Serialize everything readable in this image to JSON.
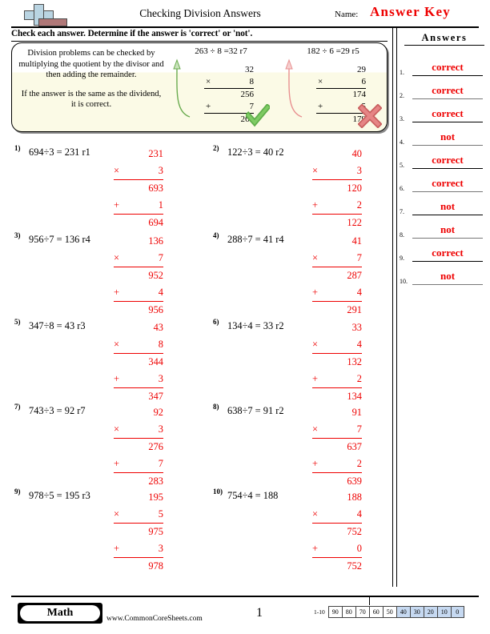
{
  "header": {
    "title": "Checking Division Answers",
    "name_label": "Name:",
    "answer_key": "Answer Key",
    "logo_icon": "plus-logo-icon"
  },
  "instruction": "Check each answer. Determine if the answer is 'correct' or 'not'.",
  "example": {
    "paragraph1": "Division problems can be checked by multiplying the quotient by the divisor and then adding the remainder.",
    "paragraph2": "If the answer is the same as the dividend, it is correct.",
    "samples": [
      {
        "heading": "263 ÷ 8 =32 r7",
        "product_top": "32",
        "mult_op": "×",
        "mult_by": "8",
        "product": "256",
        "add_op": "+",
        "remainder": "7",
        "total": "263",
        "mark": "check-mark",
        "mark_color": "#5fae4a"
      },
      {
        "heading": "182 ÷ 6 =29 r5",
        "product_top": "29",
        "mult_op": "×",
        "mult_by": "6",
        "product": "174",
        "add_op": "+",
        "remainder": "5",
        "total": "179",
        "mark": "x-mark",
        "mark_color": "#e07b7b"
      }
    ]
  },
  "problems": [
    {
      "num": "1)",
      "expr": "694÷3 = 231 r1",
      "top": "231",
      "mult_op": "×",
      "mult_by": "3",
      "product": "693",
      "add_op": "+",
      "remainder": "1",
      "total": "694"
    },
    {
      "num": "2)",
      "expr": "122÷3 = 40 r2",
      "top": "40",
      "mult_op": "×",
      "mult_by": "3",
      "product": "120",
      "add_op": "+",
      "remainder": "2",
      "total": "122"
    },
    {
      "num": "3)",
      "expr": "956÷7 = 136 r4",
      "top": "136",
      "mult_op": "×",
      "mult_by": "7",
      "product": "952",
      "add_op": "+",
      "remainder": "4",
      "total": "956"
    },
    {
      "num": "4)",
      "expr": "288÷7 = 41 r4",
      "top": "41",
      "mult_op": "×",
      "mult_by": "7",
      "product": "287",
      "add_op": "+",
      "remainder": "4",
      "total": "291"
    },
    {
      "num": "5)",
      "expr": "347÷8 = 43 r3",
      "top": "43",
      "mult_op": "×",
      "mult_by": "8",
      "product": "344",
      "add_op": "+",
      "remainder": "3",
      "total": "347"
    },
    {
      "num": "6)",
      "expr": "134÷4 = 33 r2",
      "top": "33",
      "mult_op": "×",
      "mult_by": "4",
      "product": "132",
      "add_op": "+",
      "remainder": "2",
      "total": "134"
    },
    {
      "num": "7)",
      "expr": "743÷3 = 92 r7",
      "top": "92",
      "mult_op": "×",
      "mult_by": "3",
      "product": "276",
      "add_op": "+",
      "remainder": "7",
      "total": "283"
    },
    {
      "num": "8)",
      "expr": "638÷7 = 91 r2",
      "top": "91",
      "mult_op": "×",
      "mult_by": "7",
      "product": "637",
      "add_op": "+",
      "remainder": "2",
      "total": "639"
    },
    {
      "num": "9)",
      "expr": "978÷5 = 195 r3",
      "top": "195",
      "mult_op": "×",
      "mult_by": "5",
      "product": "975",
      "add_op": "+",
      "remainder": "3",
      "total": "978"
    },
    {
      "num": "10)",
      "expr": "754÷4 = 188",
      "top": "188",
      "mult_op": "×",
      "mult_by": "4",
      "product": "752",
      "add_op": "+",
      "remainder": "0",
      "total": "752"
    }
  ],
  "answers": {
    "title": "Answers",
    "color": "#ee0000",
    "items": [
      {
        "idx": "1.",
        "value": "correct"
      },
      {
        "idx": "2.",
        "value": "correct"
      },
      {
        "idx": "3.",
        "value": "correct"
      },
      {
        "idx": "4.",
        "value": "not"
      },
      {
        "idx": "5.",
        "value": "correct"
      },
      {
        "idx": "6.",
        "value": "correct"
      },
      {
        "idx": "7.",
        "value": "not"
      },
      {
        "idx": "8.",
        "value": "not"
      },
      {
        "idx": "9.",
        "value": "correct"
      },
      {
        "idx": "10.",
        "value": "not"
      }
    ]
  },
  "footer": {
    "subject": "Math",
    "url": "www.CommonCoreSheets.com",
    "page_number": "1",
    "scale_label": "1-10",
    "scale_cells": [
      {
        "value": "90",
        "highlighted": false
      },
      {
        "value": "80",
        "highlighted": false
      },
      {
        "value": "70",
        "highlighted": false
      },
      {
        "value": "60",
        "highlighted": false
      },
      {
        "value": "50",
        "highlighted": false
      },
      {
        "value": "40",
        "highlighted": true
      },
      {
        "value": "30",
        "highlighted": true
      },
      {
        "value": "20",
        "highlighted": true
      },
      {
        "value": "10",
        "highlighted": true
      },
      {
        "value": "0",
        "highlighted": true
      }
    ]
  }
}
